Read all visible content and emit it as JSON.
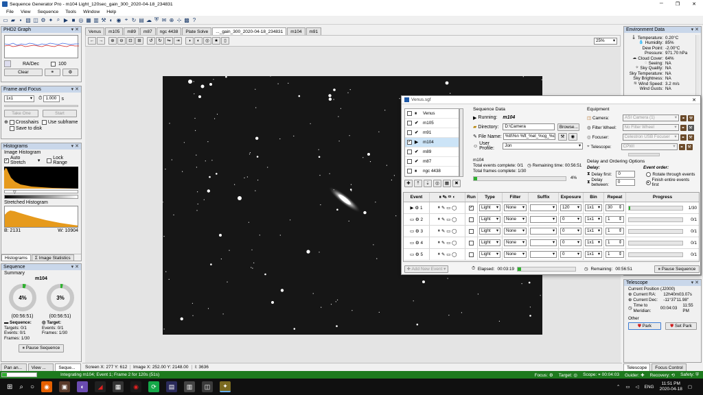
{
  "window": {
    "title": "Sequence Generator Pro - m104 Light_120sec_gain_300_2020-04-18_234831"
  },
  "menu": [
    "File",
    "View",
    "Sequence",
    "Tools",
    "Window",
    "Help"
  ],
  "phd2": {
    "title": "PHD2 Graph",
    "ra_dec_label": "RA/Dec",
    "scale_value": "100",
    "clear_label": "Clear"
  },
  "frame_focus": {
    "title": "Frame and Focus",
    "binning": "1x1",
    "exposure": "1.000",
    "exposure_unit": "s",
    "take_one_label": "Take One",
    "start_label": "Start",
    "crosshairs_label": "Crosshairs",
    "use_subframe_label": "Use subframe",
    "save_to_disk_label": "Save to disk"
  },
  "histogram": {
    "title": "Histograms",
    "image_histogram_label": "Image Histogram",
    "auto_stretch_label": "Auto Stretch",
    "lock_range_label": "Lock Range",
    "stretched_label": "Stretched Histogram",
    "b_value": "B: 2131",
    "w_value": "W: 10904",
    "tab_histograms": "Histograms",
    "tab_image_stats": "Image Statistics"
  },
  "sequence": {
    "title": "Sequence",
    "summary_label": "Summary",
    "target_name": "m104",
    "ring1": {
      "percent": 0.04,
      "label": "4%",
      "time": "(00:56:51)"
    },
    "ring2": {
      "percent": 0.03,
      "label": "3%",
      "time": "(00:56:51)"
    },
    "sequence_col": {
      "header": "Sequence:",
      "targets": "Targets:",
      "targets_val": "0/1",
      "events": "Events:",
      "events_val": "0/1",
      "frames": "Frames:",
      "frames_val": "1/30"
    },
    "target_col": {
      "header": "Target:",
      "events": "Events:",
      "events_val": "0/1",
      "frames": "Frames:",
      "frames_val": "1/30"
    },
    "pause_label": "Pause Sequence"
  },
  "bottom_left_tabs": [
    "Pan an...",
    "View ...",
    "Seque..."
  ],
  "image_tabs": [
    "Venus",
    "m105",
    "m89",
    "m87",
    "ngc 4438",
    "Plate Solve",
    "..._gain_300_2020-04-18_234831",
    "m104",
    "m91"
  ],
  "zoom": "25%",
  "status_bar": {
    "screen": "Screen X: 277 Y: 612",
    "image": "Image X: 252.00 Y: 2148.00",
    "i_val": "I: 3636"
  },
  "environment": {
    "title": "Environment Data",
    "rows": [
      {
        "label": "Temperature:",
        "value": "0.20°C",
        "icon": "thermometer-icon"
      },
      {
        "label": "Humidity:",
        "value": "85%",
        "icon": "humidity-icon"
      },
      {
        "label": "Dew Point:",
        "value": "-2.00°C",
        "icon": ""
      },
      {
        "label": "Pressure:",
        "value": "971.70 hPa",
        "icon": ""
      },
      {
        "label": "Cloud Cover:",
        "value": "64%",
        "icon": "cloud-icon"
      },
      {
        "label": "Seeing:",
        "value": "NA",
        "icon": "seeing-icon"
      },
      {
        "label": "Sky Quality:",
        "value": "NA",
        "icon": "sky-icon"
      },
      {
        "label": "Sky Temperature:",
        "value": "NA",
        "icon": ""
      },
      {
        "label": "Sky Brightness:",
        "value": "NA",
        "icon": ""
      },
      {
        "label": "Wind Speed:",
        "value": "3.2 m/s",
        "icon": "wind-icon"
      },
      {
        "label": "Wind Gusts:",
        "value": "NA",
        "icon": ""
      }
    ]
  },
  "telescope": {
    "title": "Telescope",
    "position_label": "Current Position (J2000)",
    "ra_label": "Current RA:",
    "ra": "12h40m03.07s",
    "dec_label": "Current Dec:",
    "dec": "-11°37'11.98\"",
    "meridian_label": "Time to Meridian:",
    "meridian": "00:04:03",
    "meridian_time": "11:55 PM",
    "other_label": "Other",
    "park_label": "Park",
    "set_park_label": "Set Park",
    "tab_telescope": "Telescope",
    "tab_focus": "Focus Control"
  },
  "dialog": {
    "title": "Venus.sgf",
    "targets": [
      {
        "name": "Venus",
        "checked": false,
        "state": "paused"
      },
      {
        "name": "m105",
        "checked": false,
        "state": "done"
      },
      {
        "name": "m91",
        "checked": false,
        "state": "done"
      },
      {
        "name": "m104",
        "checked": true,
        "state": "running"
      },
      {
        "name": "m89",
        "checked": false,
        "state": "done"
      },
      {
        "name": "m87",
        "checked": false,
        "state": "done"
      },
      {
        "name": "ngc 4438",
        "checked": false,
        "state": "paused"
      }
    ],
    "seqdata": {
      "title": "Sequence Data",
      "running_label": "Running:",
      "running_value": "m104",
      "directory_label": "Directory:",
      "directory_value": "D:\\Camera",
      "browse_label": "Browse...",
      "filename_label": "File Name:",
      "filename_value": "%tt\\%n %ft_%el_%cg_%dt_",
      "profile_label": "User Profile:",
      "profile_value": "Jon"
    },
    "target_summary": {
      "name": "m104",
      "events": "Total events complete: 0/1",
      "remaining": "Remaining time: 00:56:51",
      "frames": "Total frames complete: 1/30",
      "percent_label": "4%",
      "percent": 0.04
    },
    "equipment": {
      "title": "Equipment",
      "camera_label": "Camera:",
      "camera": "ASI Camera (1)",
      "filter_label": "Filter Wheel:",
      "filter": "No Filter Wheel",
      "focuser_label": "Focuser:",
      "focuser": "Celestron USB Focuser",
      "telescope_label": "Telescope:",
      "telescope": "CPWI"
    },
    "delay": {
      "title": "Delay and Ordering Options",
      "delay_label": "Delay:",
      "delay_first_label": "Delay first:",
      "delay_first": "0",
      "delay_between_label": "Delay between:",
      "delay_between": "0",
      "order_label": "Event order:",
      "rotate_label": "Rotate through events",
      "finish_label": "Finish entire events first"
    },
    "grid": {
      "headers": {
        "event": "Event",
        "run": "Run",
        "type": "Type",
        "filter": "Filter",
        "suffix": "Suffix",
        "exposure": "Exposure",
        "bin": "Bin",
        "repeat": "Repeat",
        "progress": "Progress"
      },
      "rows": [
        {
          "num": "1",
          "run": true,
          "type": "Light",
          "filter": "None",
          "suffix": "",
          "exposure": "120",
          "bin": "1x1",
          "repeat": "30",
          "progress": 0.03,
          "progress_label": "1/30"
        },
        {
          "num": "2",
          "run": false,
          "type": "Light",
          "filter": "None",
          "suffix": "",
          "exposure": "0",
          "bin": "1x1",
          "repeat": "1",
          "progress": 0,
          "progress_label": "0/1"
        },
        {
          "num": "3",
          "run": false,
          "type": "Light",
          "filter": "None",
          "suffix": "",
          "exposure": "0",
          "bin": "1x1",
          "repeat": "1",
          "progress": 0,
          "progress_label": "0/1"
        },
        {
          "num": "4",
          "run": false,
          "type": "Light",
          "filter": "None",
          "suffix": "",
          "exposure": "0",
          "bin": "1x1",
          "repeat": "1",
          "progress": 0,
          "progress_label": "0/1"
        },
        {
          "num": "5",
          "run": false,
          "type": "Light",
          "filter": "None",
          "suffix": "",
          "exposure": "0",
          "bin": "1x1",
          "repeat": "1",
          "progress": 0,
          "progress_label": "0/1"
        }
      ]
    },
    "footer": {
      "add_event_label": "Add New Event",
      "elapsed_label": "Elapsed:",
      "elapsed": "00:03:19",
      "remaining_label": "Remaining:",
      "remaining": "00:56:51",
      "pause_label": "Pause Sequence",
      "elapsed_fill": 0.06
    }
  },
  "green_status": {
    "message": "Integrating m104; Event 1; Frame 2 for 120s (51s)",
    "focus_label": "Focus:",
    "target_label": "Target:",
    "scope_label": "Scope:",
    "scope_time": "00:04:03",
    "guider_label": "Guider:",
    "recovery_label": "Recovery:",
    "safety_label": "Safety:",
    "progress": 0.13
  },
  "taskbar": {
    "lang": "ENG",
    "time": "11:51 PM",
    "date": "2020-04-18"
  },
  "colors": {
    "accent_green": "#1e7a1e",
    "panel_title": "#c9d7ea",
    "progress_green": "#2fb02f"
  }
}
